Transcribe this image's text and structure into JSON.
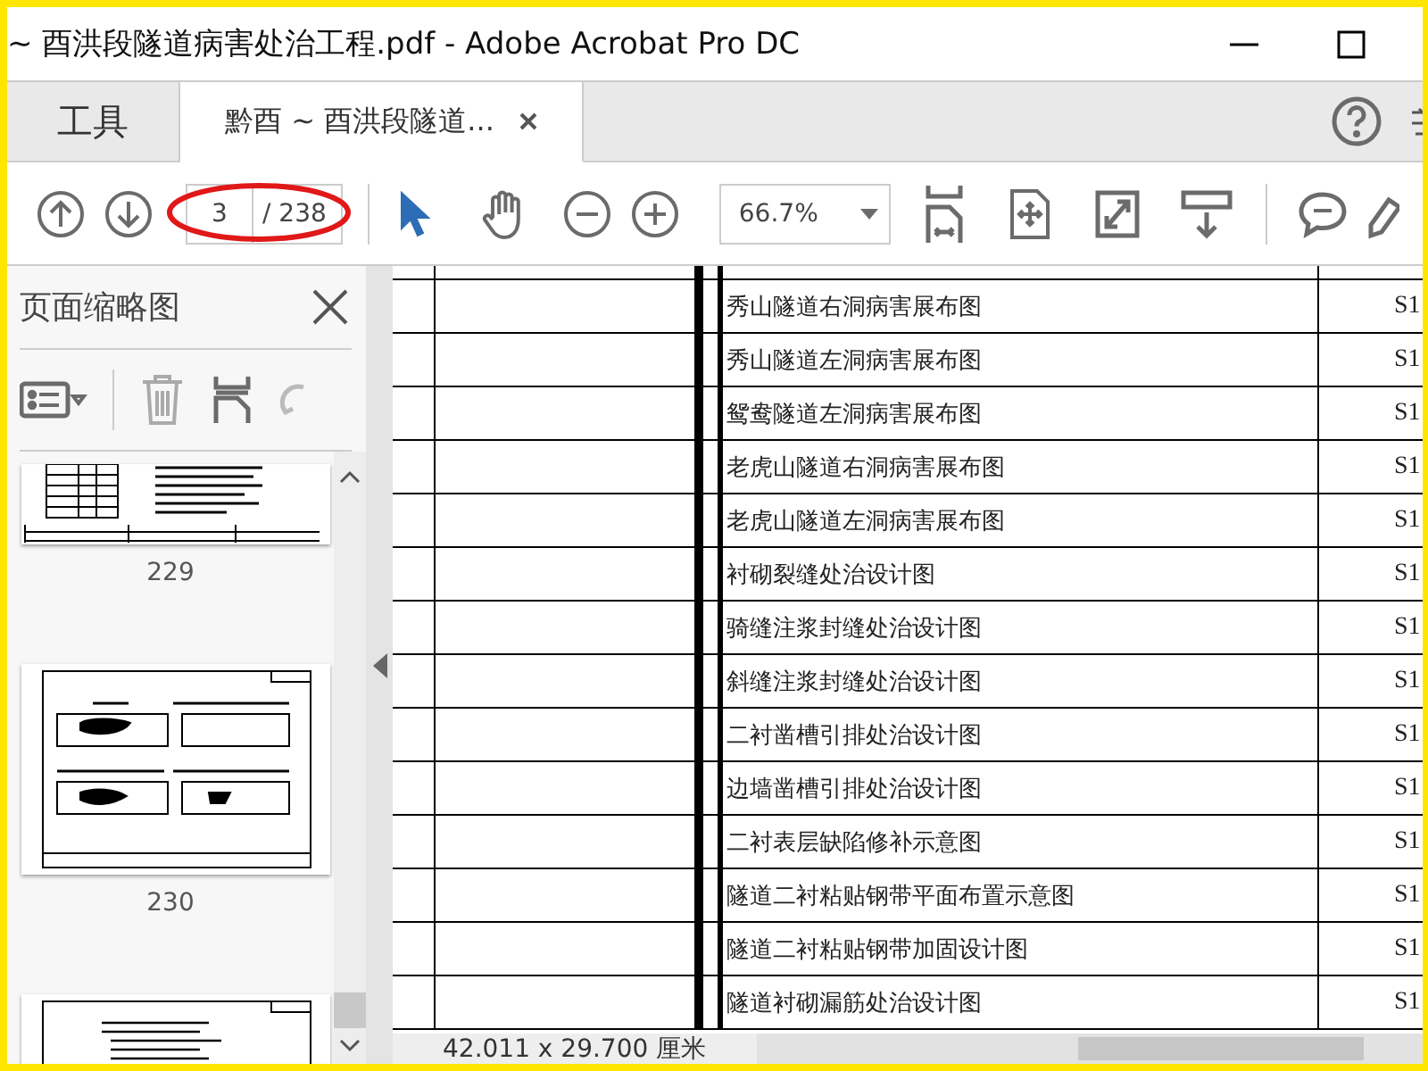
{
  "window": {
    "title": "~ 酉洪段隧道病害处治工程.pdf - Adobe Acrobat Pro DC"
  },
  "tabs": [
    {
      "label": "工具",
      "selected": false,
      "closable": false
    },
    {
      "label": "黔酉 ~ 酉洪段隧道...",
      "selected": true,
      "closable": true
    }
  ],
  "toolbar": {
    "page_number": "3",
    "page_total": "/ 238",
    "zoom": "66.7%"
  },
  "thumbnails_panel": {
    "title": "页面缩略图",
    "thumbnails": [
      {
        "kind": "table",
        "label": "229"
      },
      {
        "kind": "drawing",
        "label": "230"
      },
      {
        "kind": "text"
      }
    ]
  },
  "document": {
    "rows": [
      {
        "title": "秀山隧道右洞病害展布图",
        "code": "S1"
      },
      {
        "title": "秀山隧道左洞病害展布图",
        "code": "S1"
      },
      {
        "title": "鸳鸯隧道左洞病害展布图",
        "code": "S1"
      },
      {
        "title": "老虎山隧道右洞病害展布图",
        "code": "S1"
      },
      {
        "title": "老虎山隧道左洞病害展布图",
        "code": "S1"
      },
      {
        "title": "衬砌裂缝处治设计图",
        "code": "S1"
      },
      {
        "title": "骑缝注浆封缝处治设计图",
        "code": "S1"
      },
      {
        "title": "斜缝注浆封缝处治设计图",
        "code": "S1"
      },
      {
        "title": "二衬凿槽引排处治设计图",
        "code": "S1"
      },
      {
        "title": "边墙凿槽引排处治设计图",
        "code": "S1"
      },
      {
        "title": "二衬表层缺陷修补示意图",
        "code": "S1"
      },
      {
        "title": "隧道二衬粘贴钢带平面布置示意图",
        "code": "S1"
      },
      {
        "title": "隧道二衬粘贴钢带加固设计图",
        "code": "S1"
      },
      {
        "title": "隧道衬砌漏筋处治设计图",
        "code": "S1"
      }
    ]
  },
  "status_bar": {
    "page_size": "42.011 x 29.700 厘米"
  }
}
